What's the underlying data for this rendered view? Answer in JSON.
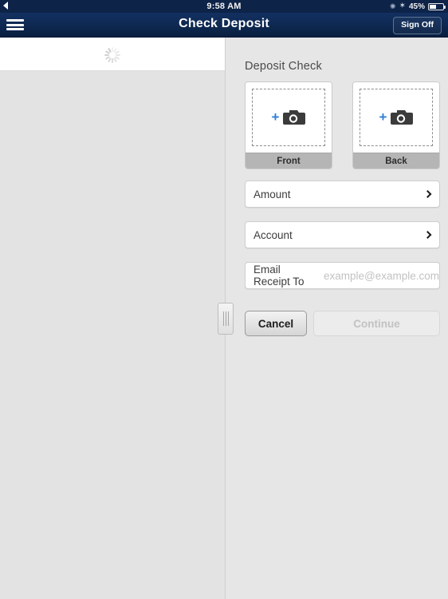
{
  "statusbar": {
    "back_icon": "back-triangle-icon",
    "time": "9:58 AM",
    "sync_icon": "sync-icon",
    "bluetooth_icon": "bluetooth-icon",
    "bluetooth_glyph": "✶",
    "battery_percent": "45%",
    "battery_icon": "battery-icon"
  },
  "navbar": {
    "menu_icon": "hamburger-menu-icon",
    "title": "Check Deposit",
    "signoff_label": "Sign Off",
    "background_color": "#0e2850"
  },
  "left_pane": {
    "loading_icon": "loading-spinner-icon",
    "background_color": "#e3e3e3"
  },
  "right_pane": {
    "section_title": "Deposit Check",
    "background_color": "#e6e6e6",
    "drag_handle_icon": "drag-handle-icon",
    "capture": [
      {
        "id": "front",
        "label": "Front",
        "camera_icon": "camera-icon",
        "plus_icon": "plus-icon",
        "plus_glyph": "+",
        "accent_color": "#2e7fd4"
      },
      {
        "id": "back",
        "label": "Back",
        "camera_icon": "camera-icon",
        "plus_icon": "plus-icon",
        "plus_glyph": "+",
        "accent_color": "#2e7fd4"
      }
    ],
    "fields": [
      {
        "id": "amount",
        "label": "Amount",
        "value": "",
        "placeholder": "",
        "chevron_icon": "chevron-right-icon"
      },
      {
        "id": "account",
        "label": "Account",
        "value": "",
        "placeholder": "",
        "chevron_icon": "chevron-right-icon"
      },
      {
        "id": "email",
        "label": "Email Receipt To",
        "value": "",
        "placeholder": "example@example.com"
      }
    ],
    "buttons": {
      "cancel_label": "Cancel",
      "continue_label": "Continue",
      "continue_disabled": true
    }
  }
}
